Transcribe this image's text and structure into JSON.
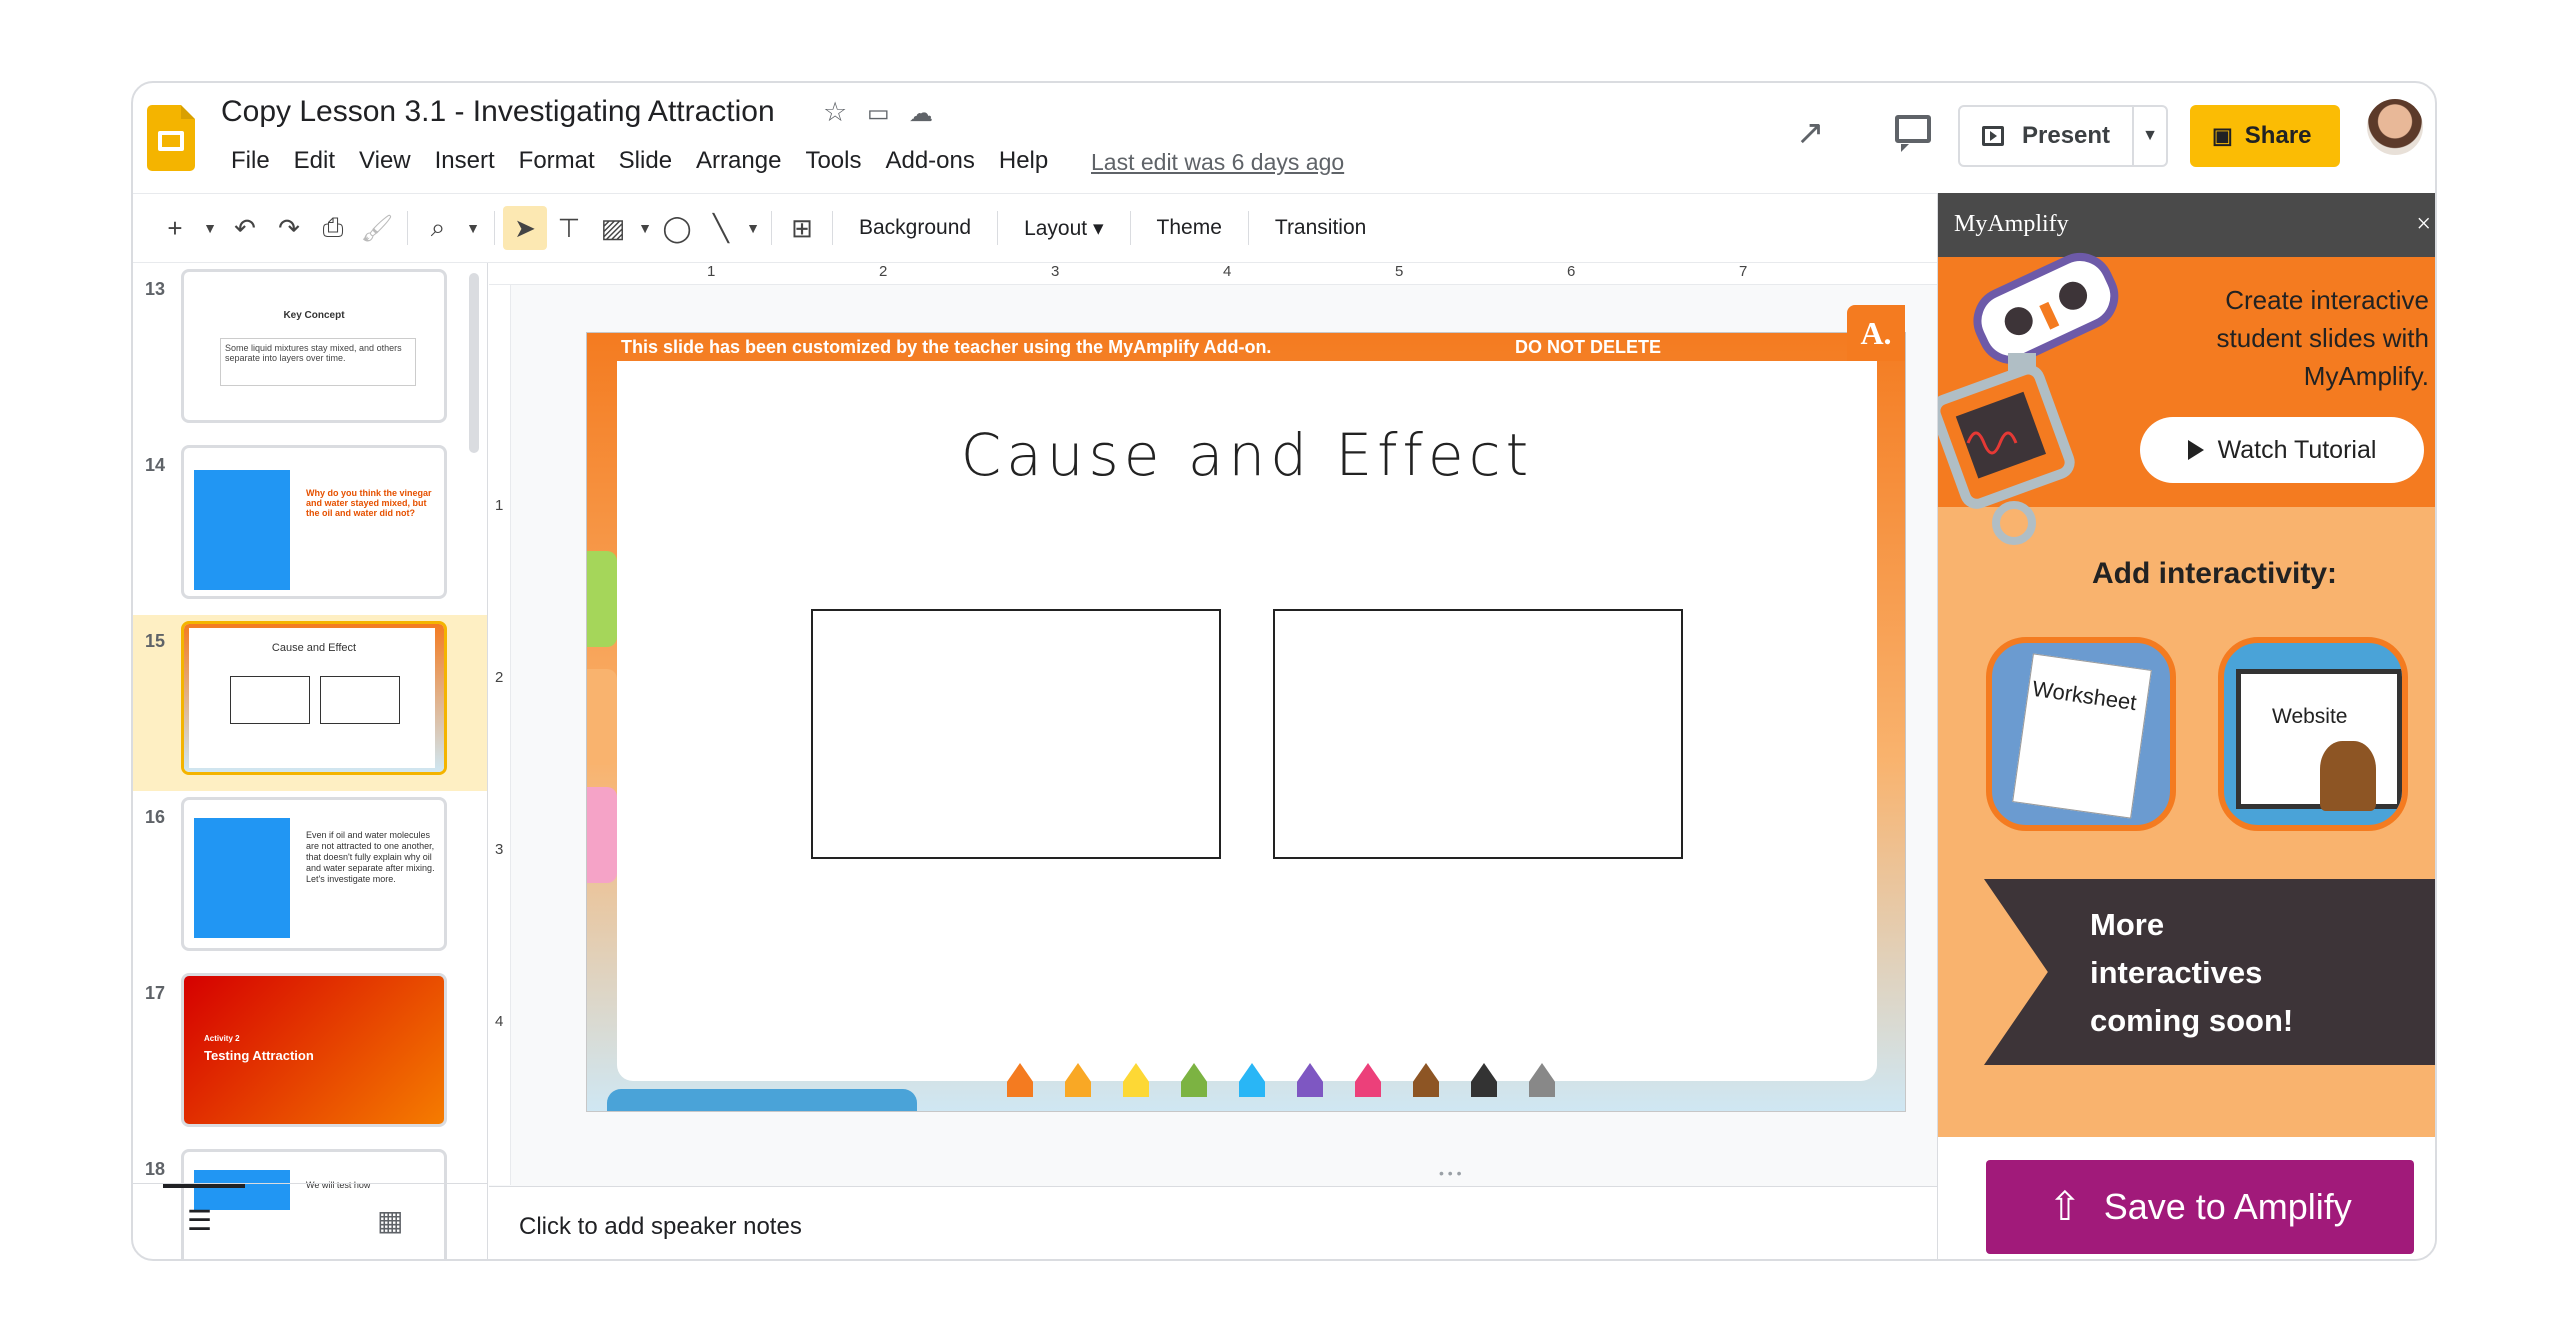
{
  "app": {
    "title": "Copy Lesson 3.1 - Investigating Attraction",
    "last_edit": "Last edit was 6 days ago",
    "menu": [
      "File",
      "Edit",
      "View",
      "Insert",
      "Format",
      "Slide",
      "Arrange",
      "Tools",
      "Add-ons",
      "Help"
    ],
    "present_label": "Present",
    "share_label": "Share"
  },
  "toolbar": {
    "background": "Background",
    "layout": "Layout",
    "theme": "Theme",
    "transition": "Transition"
  },
  "filmstrip": {
    "slides": [
      {
        "number": "13",
        "title": "Key Concept",
        "body": "Some liquid mixtures stay mixed, and others separate into layers over time."
      },
      {
        "number": "14",
        "title": "Why do you think the vinegar and water stayed mixed, but the oil and water did not?"
      },
      {
        "number": "15",
        "title": "Cause and Effect"
      },
      {
        "number": "16",
        "body": "Even if oil and water molecules are not attracted to one another, that doesn't fully explain why oil and water separate after mixing. Let's investigate more."
      },
      {
        "number": "17",
        "title": "Activity 2",
        "subtitle": "Testing Attraction"
      },
      {
        "number": "18",
        "body": "We will test how"
      }
    ]
  },
  "ruler": {
    "h": [
      "1",
      "2",
      "3",
      "4",
      "5",
      "6",
      "7"
    ],
    "v": [
      "1",
      "2",
      "3",
      "4"
    ]
  },
  "slide": {
    "banner": "This slide has been customized by the teacher using the MyAmplify Add-on.",
    "banner_right": "DO NOT DELETE",
    "badge": "A.",
    "title": "Cause and Effect"
  },
  "notes": {
    "placeholder": "Click to add speaker notes"
  },
  "panel": {
    "header": "MyAmplify",
    "close": "×",
    "promo": "Create interactive student slides with MyAmplify.",
    "watch": "Watch Tutorial",
    "add_interactivity": "Add interactivity:",
    "worksheet": "Worksheet",
    "website": "Website",
    "coming_soon": "More interactives coming soon!",
    "save": "Save to Amplify"
  }
}
